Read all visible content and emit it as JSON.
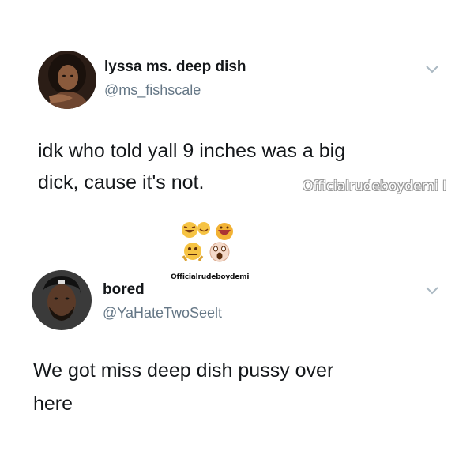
{
  "tweet1": {
    "display_name": "lyssa ms. deep dish",
    "handle": "@ms_fishscale",
    "text_line1": "idk who told yall 9 inches was a big",
    "text_line2": "dick, cause it's not.",
    "avatar_icon": "profile-photo-woman",
    "menu_icon": "chevron-down-icon"
  },
  "watermark_large": "Officialrudeboydemi",
  "watermark_large_suffix": "I",
  "emoji_icons": [
    "laughing-emoji",
    "pointing-emoji",
    "shocked-emoji",
    "screaming-emoji"
  ],
  "watermark_small": "Officialrudeboydemi",
  "tweet2": {
    "display_name": "bored",
    "handle": "@YaHateTwoSeelt",
    "text_line1": "We got miss deep dish pussy over",
    "text_line2": "here",
    "avatar_icon": "profile-photo-man",
    "menu_icon": "chevron-down-icon"
  },
  "colors": {
    "text": "#14171a",
    "handle": "#657786",
    "chevron": "#aab8c2",
    "background": "#ffffff"
  }
}
